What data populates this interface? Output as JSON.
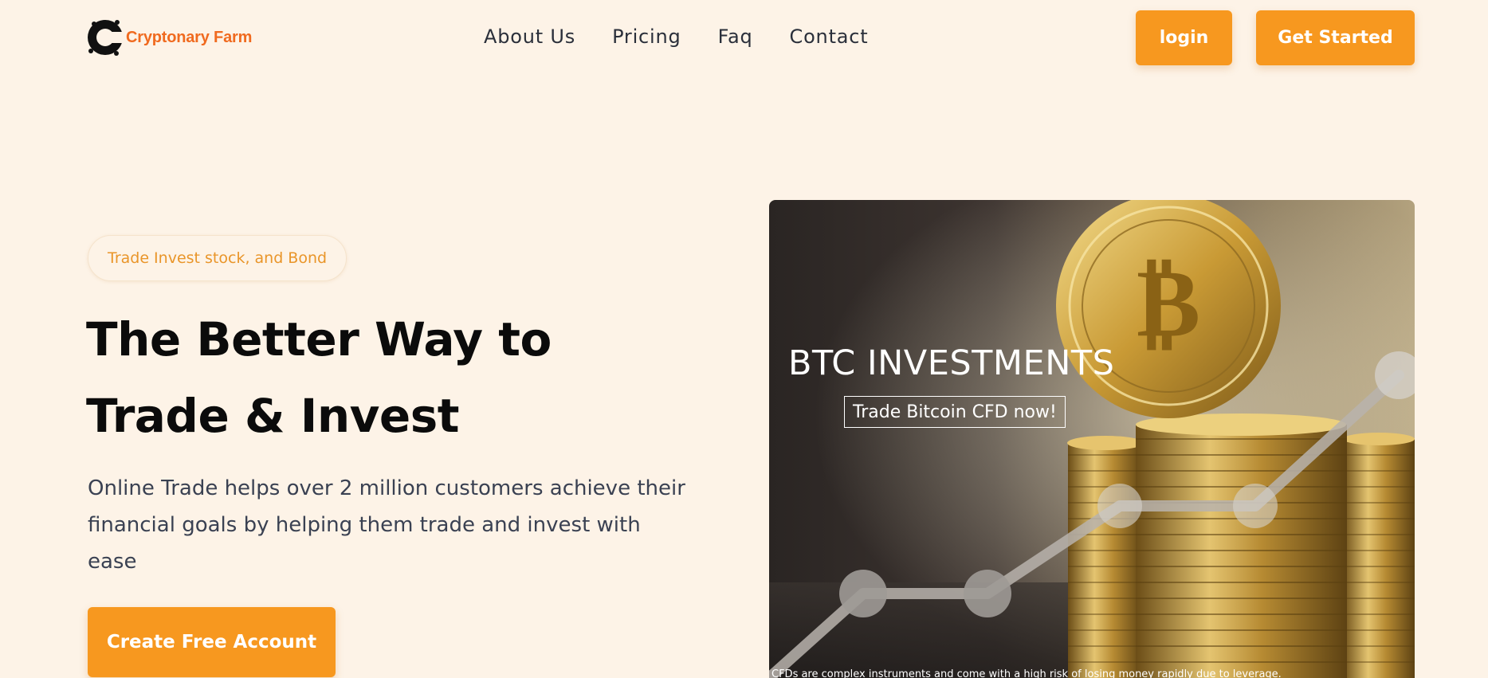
{
  "brand": {
    "name": "Cryptonary Farm",
    "logo_icon": "coin-c-logo-icon",
    "color": "#f06a1f"
  },
  "nav": {
    "items": [
      {
        "label": "About Us"
      },
      {
        "label": "Pricing"
      },
      {
        "label": "Faq"
      },
      {
        "label": "Contact"
      }
    ]
  },
  "header_actions": {
    "login_label": "login",
    "get_started_label": "Get Started"
  },
  "hero": {
    "badge": "Trade Invest stock, and Bond",
    "title_line1": "The Better Way to",
    "title_line2": "Trade & Invest",
    "description": "Online Trade helps over 2 million customers achieve their financial goals by helping them trade and invest with ease",
    "cta_label": "Create Free Account"
  },
  "hero_image": {
    "heading": "BTC INVESTMENTS",
    "cta": "Trade Bitcoin CFD now!",
    "disclaimer": "CFDs are complex instruments and come with a high risk of losing money rapidly due to leverage."
  },
  "colors": {
    "accent": "#f7981f",
    "background": "#fdf3e7",
    "badge_text": "#e99529",
    "body_text": "#3a4152"
  }
}
